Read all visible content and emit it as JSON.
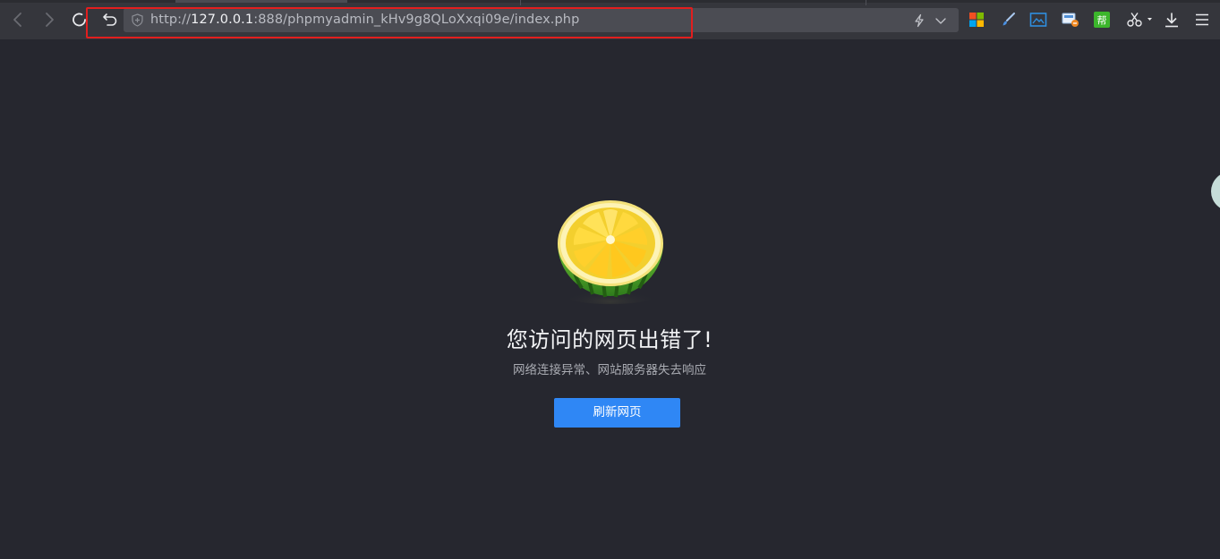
{
  "browser": {
    "url": {
      "scheme": "http://",
      "host": "127.0.0.1",
      "rest": ":888/phpmyadmin_kHv9g8QLoXxqi09e/index.php"
    },
    "icons": {
      "back": "chevron-left-icon",
      "forward": "chevron-right-icon",
      "refresh": "refresh-icon",
      "undo": "undo-icon",
      "shield": "shield-icon",
      "lightning": "lightning-icon",
      "dropdown": "chevron-down-icon"
    },
    "extensions": [
      "windows-logo-icon",
      "brush-icon",
      "screenshot-icon",
      "translate-icon",
      "help-extension-icon",
      "scissors-icon",
      "download-icon",
      "menu-icon"
    ],
    "help_extension_glyph": "帮",
    "colors": {
      "toolbar": "#35363c",
      "urlbar": "#4b4c53",
      "highlight": "#e21e1e"
    }
  },
  "error_page": {
    "title": "您访问的网页出错了!",
    "subtitle": "网络连接异常、网站服务器失去响应",
    "refresh_label": "刷新网页",
    "colors": {
      "background": "#26272f",
      "button": "#2f87f5"
    }
  }
}
